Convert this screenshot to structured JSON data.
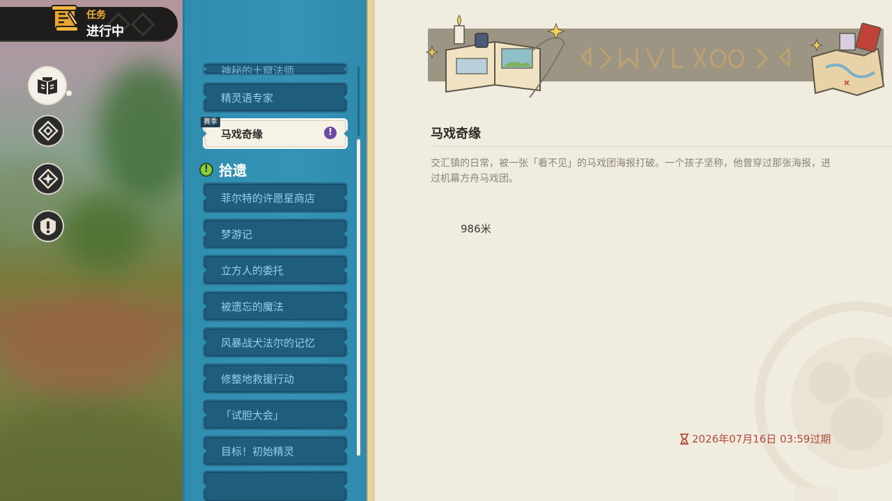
{
  "header": {
    "subtitle": "任务",
    "title": "进行中"
  },
  "sidebar": {
    "buttons": [
      {
        "name": "quest-book",
        "active": true
      },
      {
        "name": "map-marker-a",
        "active": false
      },
      {
        "name": "map-marker-b",
        "active": false
      },
      {
        "name": "alert",
        "active": false
      }
    ]
  },
  "quest_list": {
    "partial_top_item": "神秘的土窟法师",
    "items_above": [
      "精灵语专家"
    ],
    "selected": {
      "tag": "赛季",
      "label": "马戏奇缘"
    },
    "section": {
      "label": "拾遗"
    },
    "items": [
      "菲尔特的许愿星商店",
      "梦游记",
      "立方人的委托",
      "被遗忘的魔法",
      "风暴战犬法尔的记忆",
      "修整地救援行动",
      "「试胆大会」",
      "目标！初始精灵"
    ]
  },
  "detail": {
    "title": "马戏奇缘",
    "description_line1": "交汇镇的日常，被一张「看不见」的马戏团海报打破。一个孩子坚称，他曾穿过那张海报，进",
    "description_line2": "过机幕方舟马戏团。",
    "distance": "986米",
    "expiry": "2026年07月16日 03:59过期"
  },
  "colors": {
    "list_bg": "#3594b6",
    "item_bg": "#1f5d7d",
    "item_text": "#8fd2ee",
    "detail_bg": "#f1ece0",
    "expiry": "#b24a3a",
    "header_accent": "#f2b23a"
  }
}
